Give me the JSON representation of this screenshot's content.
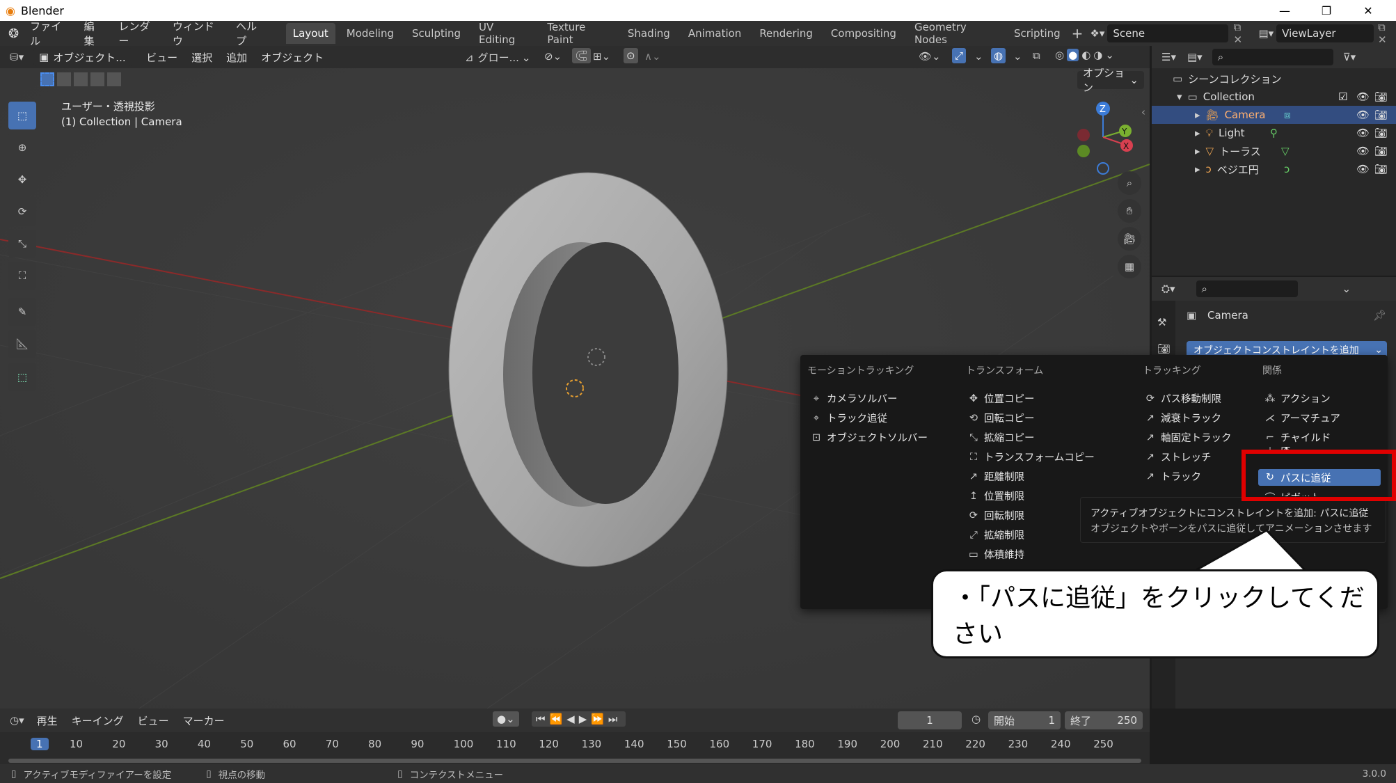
{
  "window": {
    "title": "Blender",
    "controls": [
      "—",
      "❐",
      "✕"
    ]
  },
  "topmenu": [
    "ファイル",
    "編集",
    "レンダー",
    "ウィンドウ",
    "ヘルプ"
  ],
  "workspaces": [
    "Layout",
    "Modeling",
    "Sculpting",
    "UV Editing",
    "Texture Paint",
    "Shading",
    "Animation",
    "Rendering",
    "Compositing",
    "Geometry Nodes",
    "Scripting"
  ],
  "active_workspace": "Layout",
  "scene": "Scene",
  "viewlayer": "ViewLayer",
  "viewport": {
    "mode": "オブジェクト...",
    "menus": [
      "ビュー",
      "選択",
      "追加",
      "オブジェクト"
    ],
    "transform_orientation": "グロー...",
    "options": "オプション",
    "overlay_title": "ユーザー・透視投影",
    "overlay_sub": "(1) Collection | Camera",
    "gizmo": {
      "z": "Z",
      "y": "Y",
      "x": "X"
    }
  },
  "outliner": {
    "scene_collection": "シーンコレクション",
    "collection": "Collection",
    "items": [
      "Camera",
      "Light",
      "トーラス",
      "ベジエ円"
    ]
  },
  "properties": {
    "object_name": "Camera",
    "add_constraint": "オブジェクトコンストレイントを追加"
  },
  "popup": {
    "headers": [
      "モーショントラッキング",
      "トランスフォーム",
      "トラッキング",
      "関係"
    ],
    "motion_tracking": [
      "カメラソルバー",
      "トラック追従",
      "オブジェクトソルバー"
    ],
    "transform": [
      "位置コピー",
      "回転コピー",
      "拡縮コピー",
      "トランスフォームコピー",
      "距離制限",
      "位置制限",
      "回転制限",
      "拡縮制限",
      "体積維持"
    ],
    "tracking": [
      "パス移動制限",
      "減衰トラック",
      "軸固定トラック",
      "ストレッチ",
      "トラック"
    ],
    "relations": [
      "アクション",
      "アーマチュア",
      "チャイルド",
      "床",
      "パスに追従",
      "ピボット"
    ],
    "highlighted": "パスに追従"
  },
  "tooltip": {
    "line1": "アクティブオブジェクトにコンストレイントを追加: パスに追従",
    "line2": "オブジェクトやボーンをパスに追従してアニメーションさせます"
  },
  "callout": "・「パスに追従」をクリックしてください",
  "timeline": {
    "menus": [
      "再生",
      "キーイング",
      "ビュー",
      "マーカー"
    ],
    "current_frame": "1",
    "start_label": "開始",
    "start": "1",
    "end_label": "終了",
    "end": "250",
    "ticks": [
      "1",
      "10",
      "20",
      "30",
      "40",
      "50",
      "60",
      "70",
      "80",
      "90",
      "100",
      "110",
      "120",
      "130",
      "140",
      "150",
      "160",
      "170",
      "180",
      "190",
      "200",
      "210",
      "220",
      "230",
      "240",
      "250"
    ]
  },
  "statusbar": {
    "left": "アクティブモディファイアーを設定",
    "mid": "視点の移動",
    "right": "コンテクストメニュー",
    "version": "3.0.0"
  }
}
